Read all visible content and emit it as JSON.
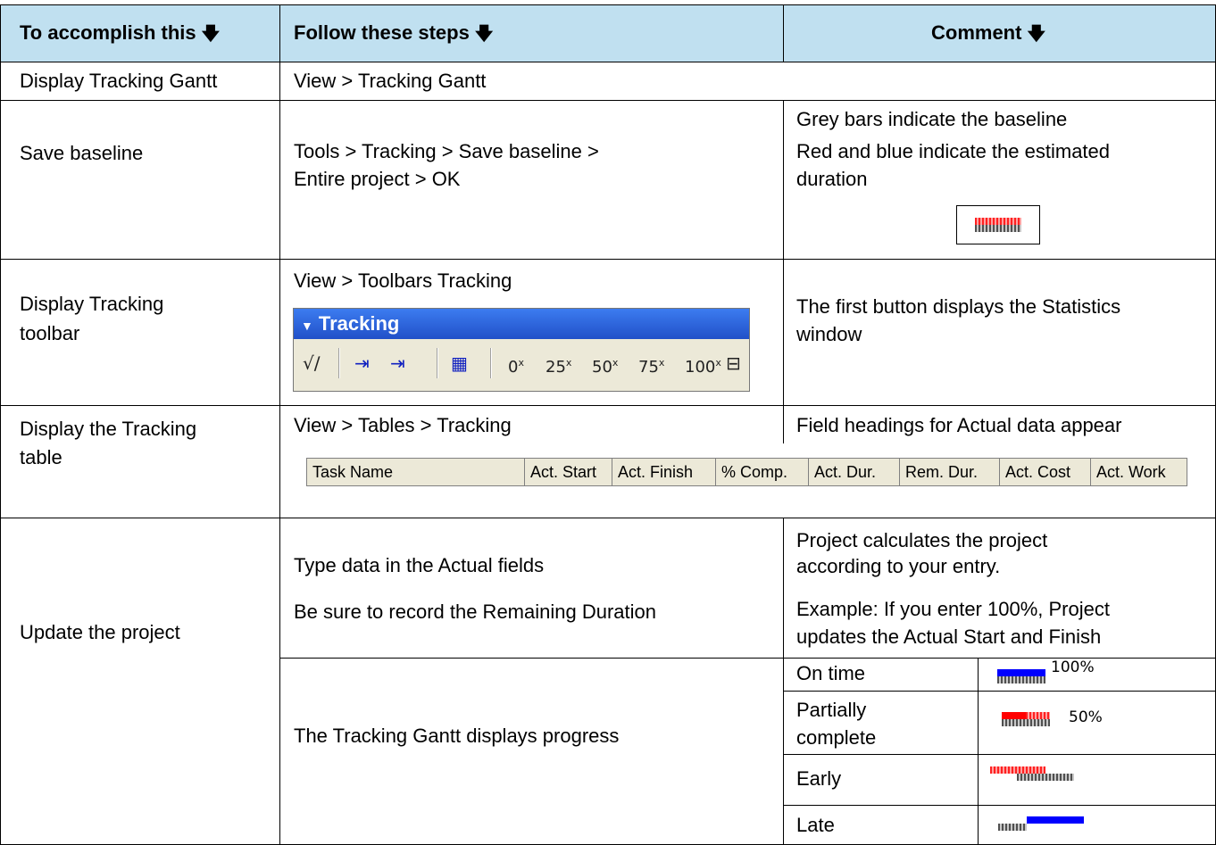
{
  "header": {
    "col1": "To accomplish this",
    "col2": "Follow these steps",
    "col3": "Comment",
    "arrow": "🡇"
  },
  "rows": {
    "r1": {
      "task": "Display Tracking Gantt",
      "steps": "View > Tracking Gantt"
    },
    "r2": {
      "task": "Save baseline",
      "steps_line1": "Tools > Tracking > Save baseline >",
      "steps_line2": "Entire project > OK",
      "comment_line1": "Grey bars indicate the baseline",
      "comment_line2": "Red and blue indicate the estimated",
      "comment_line3": "duration"
    },
    "r3": {
      "task_line1": "Display Tracking",
      "task_line2": "toolbar",
      "steps": "View > Toolbars Tracking",
      "comment_line1": "The first button displays the Statistics",
      "comment_line2": "window"
    },
    "r4": {
      "task_line1": "Display the Tracking",
      "task_line2": "table",
      "steps": "View > Tables > Tracking",
      "comment": "Field headings for Actual data appear"
    },
    "r5": {
      "task": "Update the project",
      "steps_line1": "Type data in the Actual fields",
      "steps_line2": "Be sure to record the Remaining Duration",
      "comment_line1": "Project calculates the project",
      "comment_line2": "according to your entry.",
      "comment_line3": "Example: If you enter 100%, Project",
      "comment_line4": "updates the Actual Start and Finish",
      "steps_progress": "The Tracking Gantt displays progress",
      "statuses": {
        "on_time": "On time",
        "partial_line1": "Partially",
        "partial_line2": "complete",
        "early": "Early",
        "late": "Late"
      },
      "pct_on_time": "100%",
      "pct_partial": "50%"
    }
  },
  "toolbar": {
    "title": "Tracking",
    "title_icon": "dropdown-triangle-icon",
    "buttons": [
      {
        "icon": "statistics-icon",
        "glyph": "√∕"
      },
      {
        "icon": "update-as-scheduled-icon",
        "glyph": "⇥"
      },
      {
        "icon": "reschedule-work-icon",
        "glyph": "⇥"
      },
      {
        "icon": "add-progress-line-icon",
        "glyph": "▦"
      }
    ],
    "pct_buttons": [
      "0",
      "25",
      "50",
      "75",
      "100"
    ],
    "pct_mark": "x",
    "last_icon": "update-tasks-icon",
    "last_glyph": "⊟"
  },
  "fields": [
    "Task Name",
    "Act. Start",
    "Act. Finish",
    "% Comp.",
    "Act. Dur.",
    "Rem. Dur.",
    "Act. Cost",
    "Act. Work"
  ],
  "colors": {
    "header_bg": "#c0e0f0",
    "toolbar_title": "#2a5fd8",
    "bar_blue": "#0000ff",
    "bar_red": "#ff0000",
    "baseline_grey": "#808080"
  }
}
